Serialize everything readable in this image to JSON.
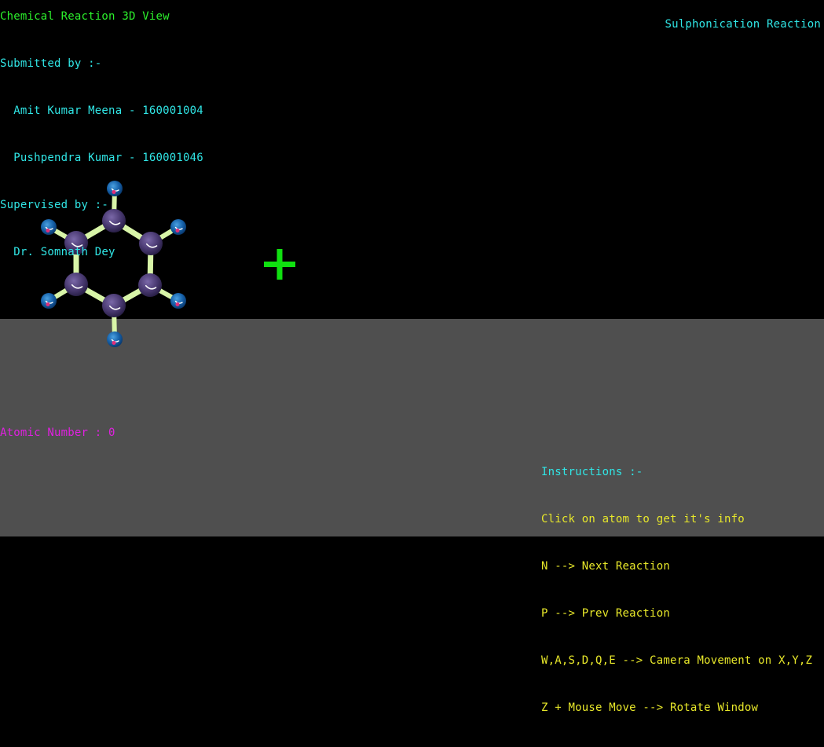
{
  "app": {
    "title": "Chemical Reaction 3D View",
    "reaction_name": "Sulphonication Reaction"
  },
  "credits": {
    "submitted_label": "Submitted by :-",
    "author1": "  Amit Kumar Meena - 160001004",
    "author2": "  Pushpendra Kumar - 160001046",
    "supervised_label": "Supervised by :-",
    "supervisor": "  Dr. Somnath Dey"
  },
  "atom_info": {
    "text": "Atomic Number : 0"
  },
  "instructions": {
    "heading": "Instructions :-",
    "lines": [
      "Click on atom to get it's info",
      "N --> Next Reaction",
      "P --> Prev Reaction",
      "W,A,S,D,Q,E --> Camera Movement on X,Y,Z",
      "Z + Mouse Move --> Rotate Window"
    ]
  },
  "molecule": {
    "name": "benzene",
    "carbon_color": "#4a3a72",
    "hydrogen_color": "#1560a8",
    "bond_color": "#d8f5a8"
  },
  "operator": {
    "symbol": "+",
    "color": "#10e010"
  },
  "colors": {
    "background": "#000000",
    "floor": "#4f4f4f"
  }
}
